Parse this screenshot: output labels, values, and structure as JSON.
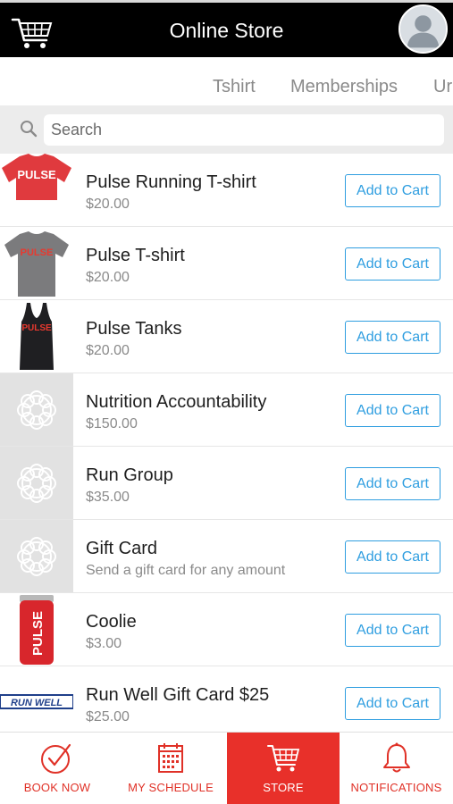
{
  "header": {
    "title": "Online Store",
    "cart_icon": "cart-icon",
    "avatar_icon": "user-avatar-icon"
  },
  "tabs": [
    {
      "label": "Tshirt"
    },
    {
      "label": "Memberships"
    },
    {
      "label": "Ur"
    }
  ],
  "search": {
    "placeholder": "Search",
    "value": ""
  },
  "items": [
    {
      "name": "Pulse Running T-shirt",
      "price": "$20.00",
      "action": "Add to Cart",
      "thumb": "red-tshirt",
      "thumb_text": "PULSE"
    },
    {
      "name": "Pulse T-shirt",
      "price": "$20.00",
      "action": "Add to Cart",
      "thumb": "gray-tshirt",
      "thumb_text": "PULSE"
    },
    {
      "name": "Pulse Tanks",
      "price": "$20.00",
      "action": "Add to Cart",
      "thumb": "black-tank",
      "thumb_text": "PULSE"
    },
    {
      "name": "Nutrition Accountability",
      "price": "$150.00",
      "action": "Add to Cart",
      "thumb": "placeholder-logo"
    },
    {
      "name": "Run Group",
      "price": "$35.00",
      "action": "Add to Cart",
      "thumb": "placeholder-logo"
    },
    {
      "name": "Gift Card",
      "price": "Send a gift card for any amount",
      "action": "Add to Cart",
      "thumb": "placeholder-logo"
    },
    {
      "name": "Coolie",
      "price": "$3.00",
      "action": "Add to Cart",
      "thumb": "red-koozie",
      "thumb_text": "PULSE"
    },
    {
      "name": "Run Well Gift Card $25",
      "price": "$25.00",
      "action": "Add to Cart",
      "thumb": "runwell-logo",
      "thumb_text": "RUN WELL"
    }
  ],
  "nav": [
    {
      "label": "BOOK NOW",
      "icon": "check-circle-icon",
      "active": false
    },
    {
      "label": "MY SCHEDULE",
      "icon": "calendar-icon",
      "active": false
    },
    {
      "label": "STORE",
      "icon": "cart-icon",
      "active": true
    },
    {
      "label": "NOTIFICATIONS",
      "icon": "bell-icon",
      "active": false
    }
  ],
  "colors": {
    "accent": "#e8302a",
    "link": "#2f9ee0",
    "header_bg": "#000000"
  }
}
